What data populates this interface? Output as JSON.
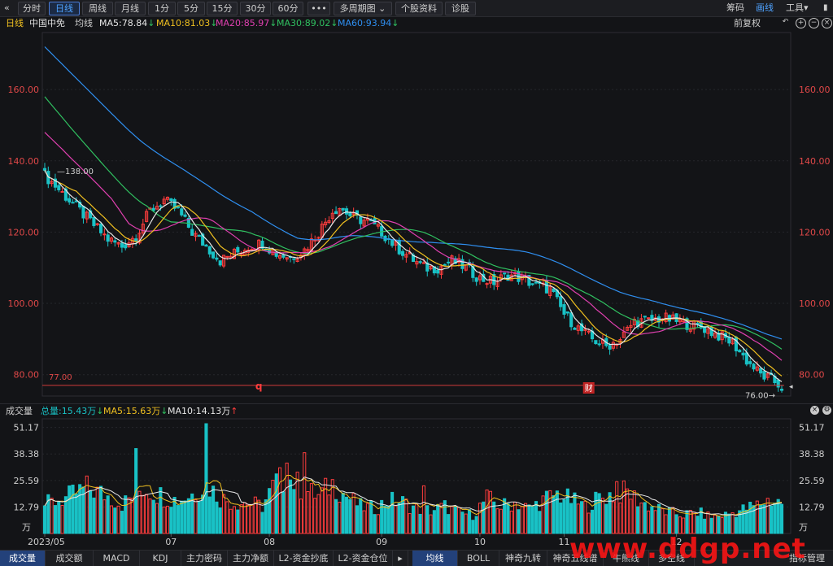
{
  "toolbar": {
    "back": "«",
    "periods": [
      {
        "label": "分时",
        "active": false
      },
      {
        "label": "日线",
        "active": true
      },
      {
        "label": "周线",
        "active": false
      },
      {
        "label": "月线",
        "active": false
      },
      {
        "label": "1分",
        "active": false
      },
      {
        "label": "5分",
        "active": false
      },
      {
        "label": "15分",
        "active": false
      },
      {
        "label": "30分",
        "active": false
      },
      {
        "label": "60分",
        "active": false
      },
      {
        "label": "•••",
        "active": false
      }
    ],
    "multi_period": "多周期图",
    "stock_info": "个股资料",
    "diagnosis": "诊股",
    "right_items": [
      {
        "label": "筹码",
        "active": false
      },
      {
        "label": "画线",
        "active": true
      },
      {
        "label": "工具▾",
        "active": false
      }
    ]
  },
  "ma_bar": {
    "period": "日线",
    "stock_name": "中国中免",
    "avg_label": "均线",
    "ma5": "MA5:78.84",
    "ma10": "MA10:81.03",
    "ma20": "MA20:85.97",
    "ma30": "MA30:89.02",
    "ma60": "MA60:93.94",
    "arrow": "↓",
    "adjust": "前复权"
  },
  "volume_bar": {
    "title": "成交量",
    "total": "总量:15.43万",
    "ma5": "MA5:15.63万",
    "ma10": "MA10:14.13万",
    "down_arrow": "↓",
    "up_arrow": "↑"
  },
  "colors": {
    "up": "#ff3d3d",
    "down": "#19c2c6",
    "ma5": "#e8e8e8",
    "ma10": "#f0c020",
    "ma20": "#e040b0",
    "ma30": "#30c060",
    "ma60": "#2f8ff0"
  },
  "chart_data": {
    "type": "candlestick",
    "price_axis": {
      "ticks": [
        "160.00",
        "140.00",
        "120.00",
        "100.00",
        "80.00"
      ],
      "ylim": [
        74,
        176
      ]
    },
    "volume_axis": {
      "ticks": [
        "51.17",
        "38.38",
        "25.59",
        "12.79"
      ],
      "unit": "万",
      "ylim": [
        0,
        53
      ]
    },
    "x_ticks": [
      "2023/05",
      "07",
      "08",
      "09",
      "10",
      "11",
      "12"
    ],
    "annotations": {
      "high_label": "138.00",
      "low_label": "76.00",
      "line_value_label": "77.00",
      "line_value": 77.0,
      "marker_q": "q",
      "marker_cai": "财"
    },
    "price_anchors": [
      [
        0,
        136
      ],
      [
        6,
        130
      ],
      [
        12,
        124
      ],
      [
        18,
        118
      ],
      [
        22,
        116
      ],
      [
        26,
        119
      ],
      [
        30,
        126
      ],
      [
        34,
        129
      ],
      [
        38,
        126
      ],
      [
        42,
        120
      ],
      [
        46,
        116
      ],
      [
        50,
        112
      ],
      [
        54,
        114
      ],
      [
        58,
        116
      ],
      [
        62,
        117
      ],
      [
        66,
        114
      ],
      [
        70,
        113
      ],
      [
        74,
        115
      ],
      [
        78,
        120
      ],
      [
        82,
        126
      ],
      [
        84,
        127
      ],
      [
        88,
        124
      ],
      [
        92,
        123
      ],
      [
        96,
        120
      ],
      [
        100,
        116
      ],
      [
        104,
        113
      ],
      [
        108,
        110
      ],
      [
        112,
        110
      ],
      [
        116,
        112
      ],
      [
        120,
        110
      ],
      [
        124,
        107
      ],
      [
        128,
        106
      ],
      [
        132,
        108
      ],
      [
        136,
        107
      ],
      [
        140,
        105
      ],
      [
        144,
        104
      ],
      [
        148,
        97
      ],
      [
        152,
        93
      ],
      [
        156,
        90
      ],
      [
        160,
        88
      ],
      [
        164,
        90
      ],
      [
        168,
        95
      ],
      [
        172,
        95
      ],
      [
        176,
        96
      ],
      [
        180,
        95
      ],
      [
        184,
        94
      ],
      [
        188,
        93
      ],
      [
        192,
        91
      ],
      [
        196,
        89
      ],
      [
        200,
        84
      ],
      [
        204,
        80
      ],
      [
        208,
        78
      ],
      [
        210,
        76.5
      ]
    ],
    "volume_anchors": [
      [
        0,
        14
      ],
      [
        6,
        17
      ],
      [
        12,
        22
      ],
      [
        18,
        18
      ],
      [
        22,
        14
      ],
      [
        28,
        22
      ],
      [
        34,
        18
      ],
      [
        38,
        16
      ],
      [
        42,
        19
      ],
      [
        46,
        24
      ],
      [
        50,
        17
      ],
      [
        54,
        15
      ],
      [
        58,
        15
      ],
      [
        62,
        13
      ],
      [
        66,
        25
      ],
      [
        70,
        26
      ],
      [
        74,
        21
      ],
      [
        78,
        18
      ],
      [
        82,
        24
      ],
      [
        86,
        18
      ],
      [
        90,
        13
      ],
      [
        94,
        12
      ],
      [
        98,
        16
      ],
      [
        102,
        15
      ],
      [
        106,
        12
      ],
      [
        110,
        11
      ],
      [
        114,
        13
      ],
      [
        118,
        10
      ],
      [
        122,
        9
      ],
      [
        126,
        17
      ],
      [
        130,
        13
      ],
      [
        134,
        15
      ],
      [
        138,
        12
      ],
      [
        142,
        16
      ],
      [
        146,
        19
      ],
      [
        150,
        16
      ],
      [
        154,
        13
      ],
      [
        158,
        17
      ],
      [
        162,
        19
      ],
      [
        166,
        20
      ],
      [
        170,
        15
      ],
      [
        174,
        12
      ],
      [
        178,
        10
      ],
      [
        182,
        9
      ],
      [
        186,
        10
      ],
      [
        190,
        8
      ],
      [
        194,
        9
      ],
      [
        198,
        11
      ],
      [
        202,
        13
      ],
      [
        206,
        16
      ],
      [
        210,
        15
      ]
    ],
    "volume_spikes": [
      [
        26,
        41
      ],
      [
        46,
        53
      ],
      [
        69,
        34
      ],
      [
        74,
        39
      ],
      [
        108,
        23
      ],
      [
        163,
        25
      ]
    ],
    "ma5_latest": 78.84,
    "ma10_latest": 81.03,
    "ma20_latest": 85.97,
    "ma30_latest": 89.02,
    "ma60_latest": 93.94,
    "ma60_start": 172,
    "ma30_start": 158,
    "ma20_start": 148
  },
  "bottom_tabs_left": [
    {
      "label": "成交量",
      "active": true
    },
    {
      "label": "成交额",
      "active": false
    },
    {
      "label": "MACD",
      "active": false
    },
    {
      "label": "KDJ",
      "active": false
    },
    {
      "label": "主力密码",
      "active": false
    },
    {
      "label": "主力净额",
      "active": false
    },
    {
      "label": "L2-资金抄底",
      "active": false
    },
    {
      "label": "L2-资金仓位",
      "active": false
    }
  ],
  "bottom_tabs_right": [
    {
      "label": "均线",
      "active": true
    },
    {
      "label": "BOLL",
      "active": false
    },
    {
      "label": "神奇九转",
      "active": false
    },
    {
      "label": "神奇五线谱",
      "active": false
    },
    {
      "label": "牛熊线",
      "active": false
    },
    {
      "label": "多空线",
      "active": false
    },
    {
      "label": "指标管理",
      "active": false
    }
  ],
  "watermark": "www.ddgp.net"
}
